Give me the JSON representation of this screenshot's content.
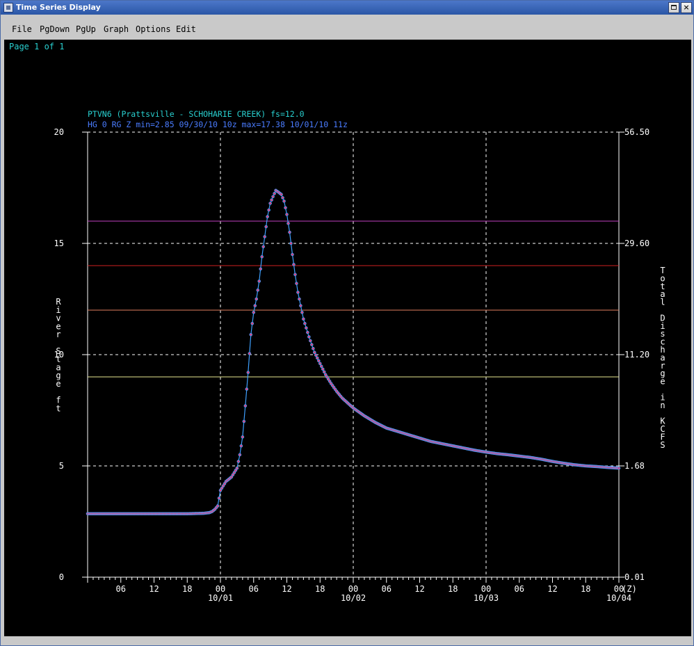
{
  "window": {
    "title": "Time Series Display",
    "icon": "app-window-icon",
    "controls": {
      "maximize_icon": "maximize-icon",
      "close_icon": "close-icon",
      "close_glyph": "×"
    }
  },
  "menu": [
    {
      "label": "File"
    },
    {
      "label": "PgDown"
    },
    {
      "label": "PgUp"
    },
    {
      "label": "Graph"
    },
    {
      "label": "Options"
    },
    {
      "label": "Edit"
    }
  ],
  "page_indicator": "Page 1 of 1",
  "colors": {
    "background": "#000000",
    "text_cyan": "#29d0d0",
    "text_blue": "#4a7cff",
    "series_line": "#3ea0ff",
    "series_point": "#e0407a",
    "grid": "#ffffff",
    "threshold_magenta": "#c040c0",
    "threshold_red": "#d02020",
    "threshold_salmon": "#e08060",
    "threshold_yellow": "#e8e890"
  },
  "chart_data": {
    "type": "line",
    "title": "PTVN6 (Prattsville - SCHOHARIE CREEK) fs=12.0",
    "subtitle": "HG 0 RG Z min=2.85 09/30/10 10z max=17.38 10/01/10 11z",
    "ylabel": "River Stage ft",
    "ylabel_right": "Total Discharge in KCFS",
    "ylim": [
      0,
      20
    ],
    "yticks": [
      "0",
      "5",
      "10",
      "15",
      "20"
    ],
    "yticks_right": [
      "0.01",
      "1.68",
      "11.20",
      "29.60",
      "56.50"
    ],
    "xlim_hours": [
      0,
      96
    ],
    "xticks": [
      "06",
      "12",
      "18",
      "00",
      "06",
      "12",
      "18",
      "00",
      "06",
      "12",
      "18",
      "00",
      "06",
      "12",
      "18",
      "00",
      "(Z)"
    ],
    "date_labels": [
      "10/01",
      "10/02",
      "10/03",
      "10/04"
    ],
    "x_anchor": "09/30/10 03z",
    "thresholds": [
      {
        "value": 16,
        "color": "#c040c0"
      },
      {
        "value": 14,
        "color": "#d02020"
      },
      {
        "value": 12,
        "color": "#e08060"
      },
      {
        "value": 9,
        "color": "#e8e890"
      }
    ],
    "grid": true,
    "series": [
      {
        "x": [
          0,
          3,
          6,
          9,
          12,
          15,
          18,
          21,
          22,
          22.5,
          23,
          23.5,
          24,
          25,
          26,
          27,
          27.5,
          28,
          28.5,
          29,
          29.5,
          30,
          30.5,
          31,
          31.5,
          32,
          32.5,
          33,
          33.5,
          34,
          34.5,
          35,
          35.5,
          36,
          36.5,
          37,
          37.5,
          38,
          38.5,
          39,
          39.5,
          40,
          41,
          42,
          43,
          44,
          45,
          46,
          48,
          50,
          52,
          54,
          56,
          58,
          60,
          62,
          64,
          66,
          68,
          70,
          72,
          74,
          76,
          78,
          80,
          82,
          84,
          86,
          88,
          90,
          92,
          94,
          96
        ],
        "y": [
          2.85,
          2.85,
          2.85,
          2.85,
          2.85,
          2.85,
          2.85,
          2.87,
          2.9,
          2.95,
          3.05,
          3.2,
          3.9,
          4.3,
          4.5,
          4.9,
          5.5,
          6.3,
          7.7,
          9.2,
          10.9,
          11.9,
          12.5,
          13.3,
          14.4,
          15.3,
          16.2,
          16.8,
          17.1,
          17.38,
          17.3,
          17.2,
          16.9,
          16.3,
          15.5,
          14.5,
          13.6,
          12.8,
          12.2,
          11.6,
          11.2,
          10.8,
          10.1,
          9.6,
          9.1,
          8.7,
          8.35,
          8.05,
          7.6,
          7.25,
          6.95,
          6.7,
          6.55,
          6.4,
          6.25,
          6.1,
          6.0,
          5.9,
          5.8,
          5.7,
          5.62,
          5.55,
          5.5,
          5.44,
          5.38,
          5.3,
          5.2,
          5.12,
          5.05,
          5.0,
          4.97,
          4.93,
          4.9
        ]
      }
    ]
  }
}
